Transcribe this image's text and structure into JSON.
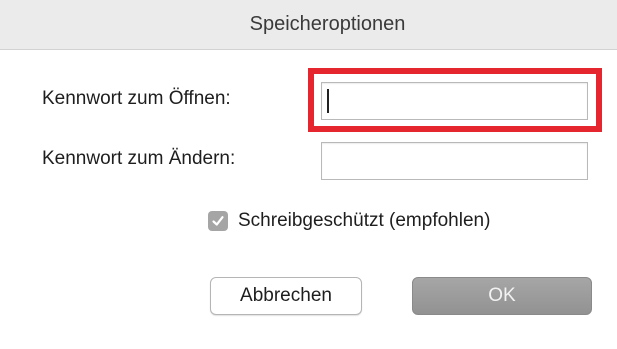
{
  "dialog": {
    "title": "Speicheroptionen"
  },
  "fields": {
    "open_label": "Kennwort zum Öffnen:",
    "open_value": "",
    "change_label": "Kennwort zum Ändern:",
    "change_value": ""
  },
  "options": {
    "readonly_label": "Schreibgeschützt (empfohlen)",
    "readonly_checked": true
  },
  "buttons": {
    "cancel_label": "Abbrechen",
    "ok_label": "OK"
  },
  "colors": {
    "highlight": "#e5262f",
    "checkbox_fill": "#a5a5a5",
    "ok_button": "#9c9c9c"
  },
  "icons": {
    "checkbox": "checkmark-icon"
  }
}
